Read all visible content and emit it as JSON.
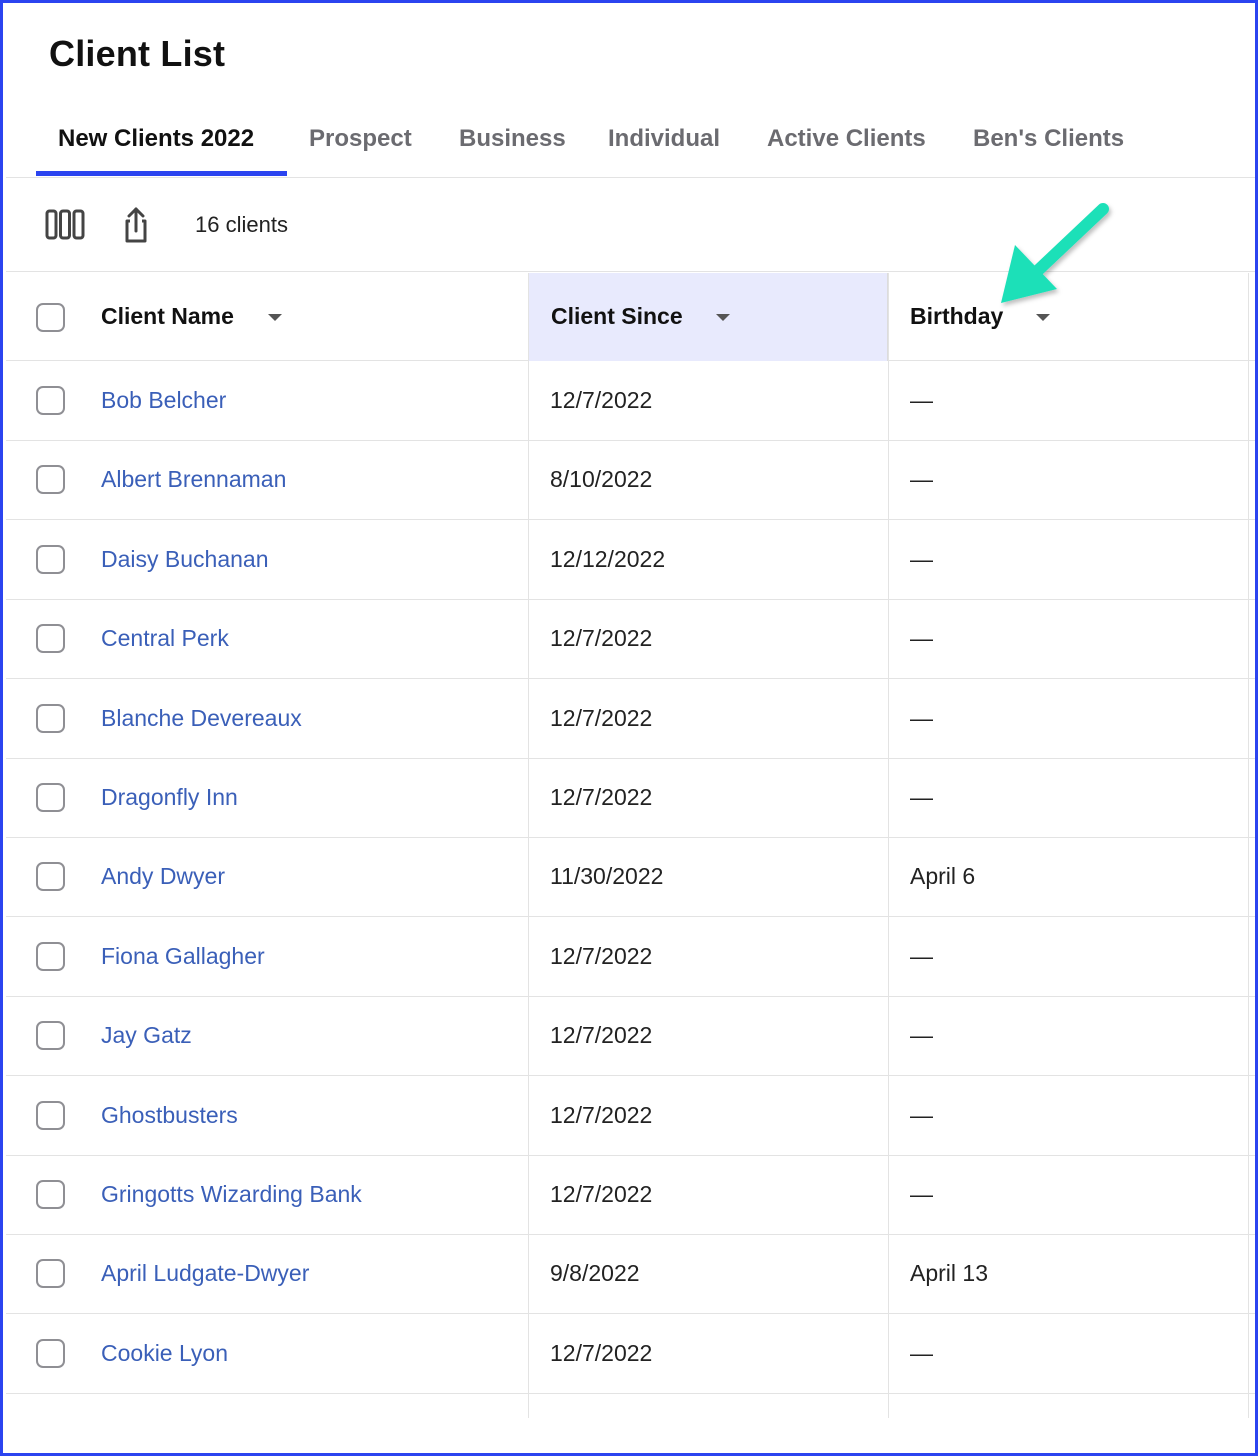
{
  "page": {
    "title": "Client List"
  },
  "tabs": [
    {
      "label": "New Clients 2022",
      "active": true
    },
    {
      "label": "Prospect",
      "active": false
    },
    {
      "label": "Business",
      "active": false
    },
    {
      "label": "Individual",
      "active": false
    },
    {
      "label": "Active Clients",
      "active": false
    },
    {
      "label": "Ben's Clients",
      "active": false
    }
  ],
  "toolbar": {
    "columns_icon": "columns-icon",
    "export_icon": "share-export-icon",
    "count_label": "16 clients"
  },
  "table": {
    "headers": {
      "name": "Client Name",
      "since": "Client Since",
      "birthday": "Birthday"
    },
    "sorted_column": "since",
    "rows": [
      {
        "name": "Bob Belcher",
        "since": "12/7/2022",
        "birthday": "—"
      },
      {
        "name": "Albert Brennaman",
        "since": "8/10/2022",
        "birthday": "—"
      },
      {
        "name": "Daisy Buchanan",
        "since": "12/12/2022",
        "birthday": "—"
      },
      {
        "name": "Central Perk",
        "since": "12/7/2022",
        "birthday": "—"
      },
      {
        "name": "Blanche Devereaux",
        "since": "12/7/2022",
        "birthday": "—"
      },
      {
        "name": "Dragonfly Inn",
        "since": "12/7/2022",
        "birthday": "—"
      },
      {
        "name": "Andy Dwyer",
        "since": "11/30/2022",
        "birthday": "April 6"
      },
      {
        "name": "Fiona Gallagher",
        "since": "12/7/2022",
        "birthday": "—"
      },
      {
        "name": "Jay Gatz",
        "since": "12/7/2022",
        "birthday": "—"
      },
      {
        "name": "Ghostbusters",
        "since": "12/7/2022",
        "birthday": "—"
      },
      {
        "name": "Gringotts Wizarding Bank",
        "since": "12/7/2022",
        "birthday": "—"
      },
      {
        "name": "April Ludgate-Dwyer",
        "since": "9/8/2022",
        "birthday": "April 13"
      },
      {
        "name": "Cookie Lyon",
        "since": "12/7/2022",
        "birthday": "—"
      }
    ]
  },
  "annotation": {
    "arrow_color": "#1ee0b8",
    "accent": "#2b44f0",
    "link_color": "#3a5fb8",
    "sorted_bg": "#e8eafd"
  }
}
